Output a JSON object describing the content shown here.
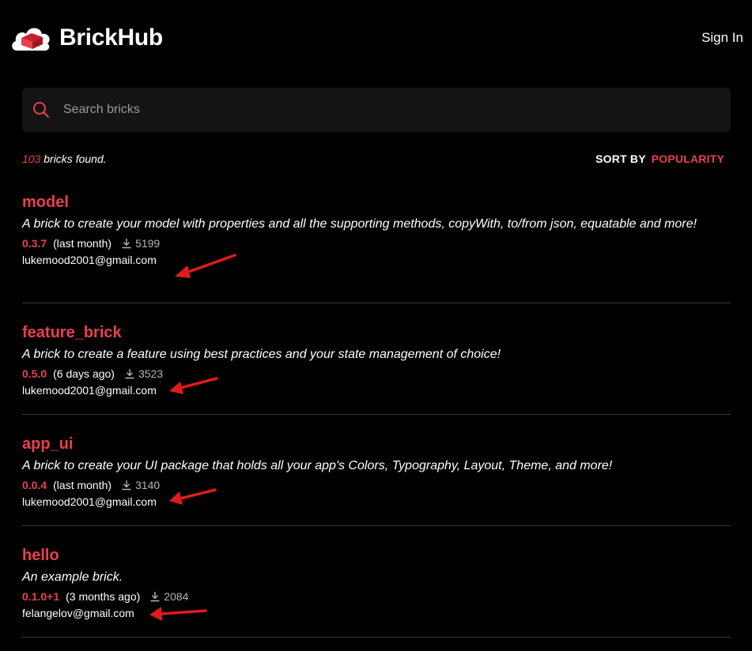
{
  "header": {
    "brand": "BrickHub",
    "signin_label": "Sign In"
  },
  "search": {
    "placeholder": "Search bricks",
    "value": ""
  },
  "results": {
    "count": "103",
    "count_suffix": " bricks found.",
    "sort_label": "SORT BY",
    "sort_value": "POPULARITY"
  },
  "bricks": [
    {
      "name": "model",
      "description": "A brick to create your model with properties and all the supporting methods, copyWith, to/from json, equatable and more!",
      "version": "0.3.7",
      "updated": "(last month)",
      "downloads": "5199",
      "author": "lukemood2001@gmail.com"
    },
    {
      "name": "feature_brick",
      "description": "A brick to create a feature using best practices and your state management of choice!",
      "version": "0.5.0",
      "updated": "(6 days ago)",
      "downloads": "3523",
      "author": "lukemood2001@gmail.com"
    },
    {
      "name": "app_ui",
      "description": "A brick to create your UI package that holds all your app's Colors, Typography, Layout, Theme, and more!",
      "version": "0.0.4",
      "updated": "(last month)",
      "downloads": "3140",
      "author": "lukemood2001@gmail.com"
    },
    {
      "name": "hello",
      "description": "An example brick.",
      "version": "0.1.0+1",
      "updated": "(3 months ago)",
      "downloads": "2084",
      "author": "felangelov@gmail.com"
    }
  ],
  "colors": {
    "accent": "#e8404f",
    "annotation_arrow": "#e01b1b",
    "background": "#000000",
    "search_bg": "#141414"
  }
}
